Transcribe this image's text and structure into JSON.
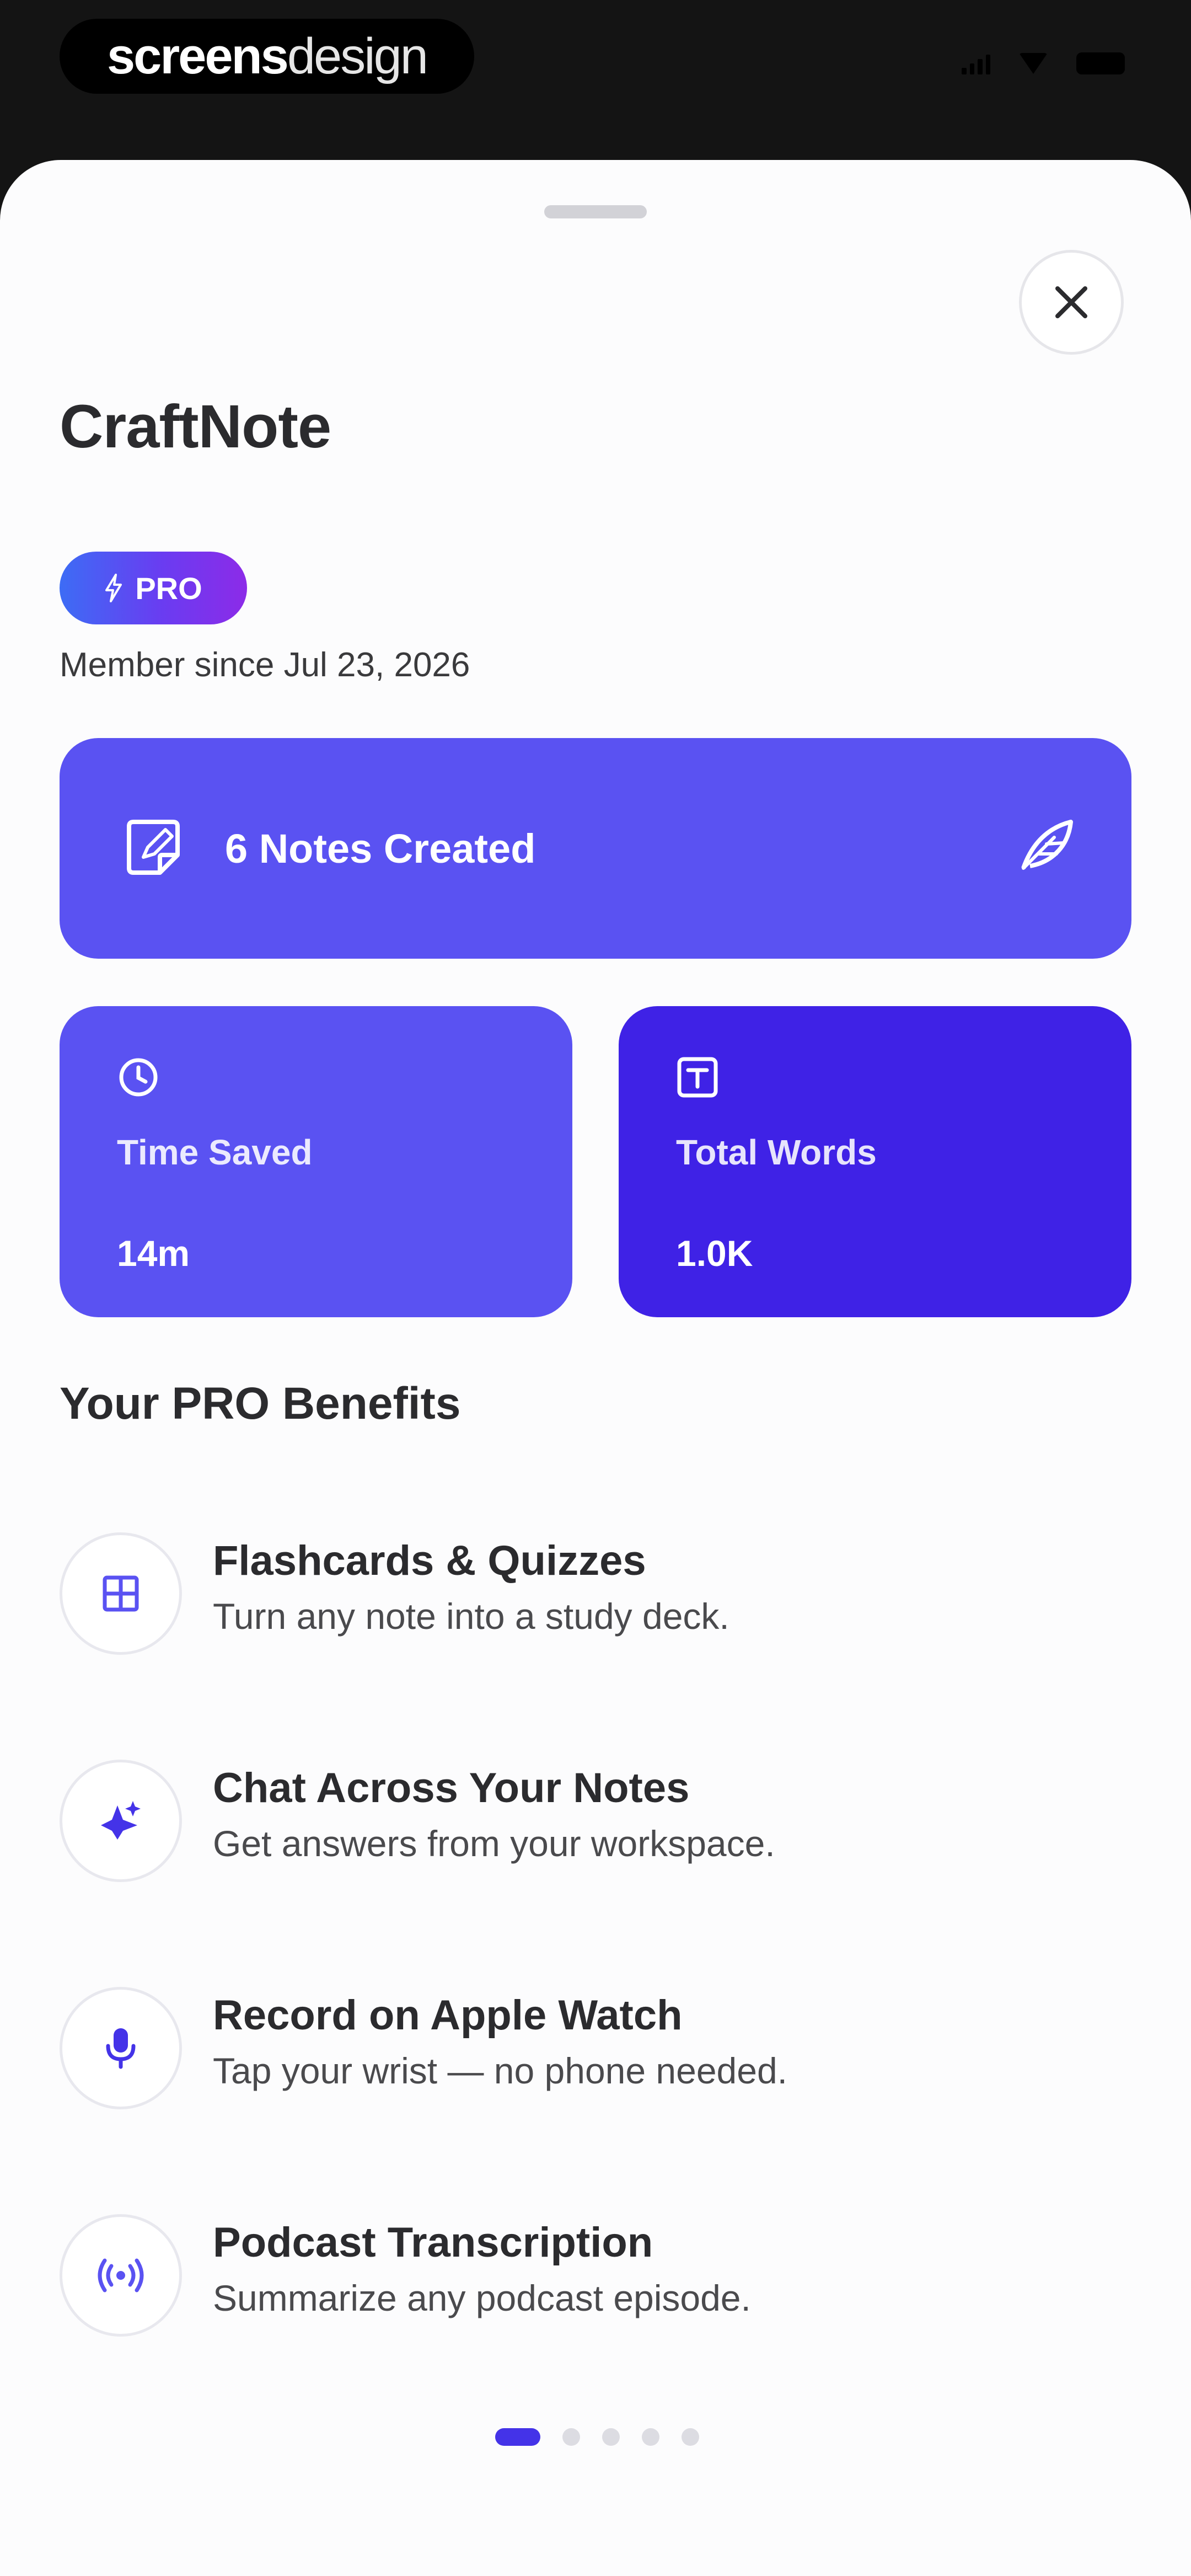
{
  "brand": {
    "bold": "screens",
    "light": "design"
  },
  "app": {
    "title": "CraftNote"
  },
  "badge": {
    "label": "PRO"
  },
  "member": {
    "text": "Member since Jul 23, 2026"
  },
  "stats": {
    "notes": {
      "label": "6 Notes Created"
    },
    "time_saved": {
      "label": "Time Saved",
      "value": "14m"
    },
    "total_words": {
      "label": "Total Words",
      "value": "1.0K"
    }
  },
  "benefits_title": "Your PRO Benefits",
  "benefits": [
    {
      "title": "Flashcards & Quizzes",
      "desc": "Turn any note into a study deck.",
      "icon": "grid-icon"
    },
    {
      "title": "Chat Across Your Notes",
      "desc": "Get answers from your workspace.",
      "icon": "sparkle-icon"
    },
    {
      "title": "Record on Apple Watch",
      "desc": "Tap your wrist — no phone needed.",
      "icon": "microphone-icon"
    },
    {
      "title": "Podcast Transcription",
      "desc": "Summarize any podcast episode.",
      "icon": "podcast-icon"
    }
  ],
  "pagination": {
    "total": 5,
    "active": 1
  },
  "colors": {
    "accent": "#5a52f2",
    "accent_dark": "#3f22e6",
    "dot_active": "#4433e8"
  }
}
